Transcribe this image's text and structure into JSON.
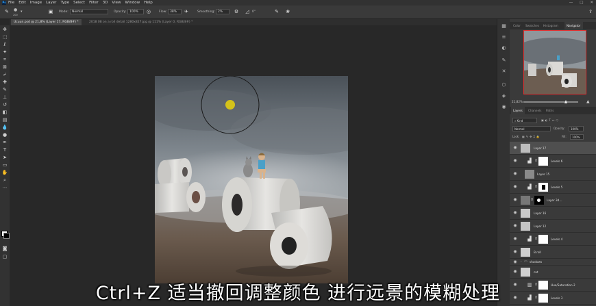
{
  "app": {
    "logo": "Ps"
  },
  "menubar": {
    "items": [
      "File",
      "Edit",
      "Image",
      "Layer",
      "Type",
      "Select",
      "Filter",
      "3D",
      "View",
      "Window",
      "Help"
    ]
  },
  "window_controls": {
    "minimize": "—",
    "maximize": "□",
    "close": "✕"
  },
  "options": {
    "brush_size": "200",
    "mode_label": "Mode:",
    "mode_value": "Normal",
    "opacity_label": "Opacity:",
    "opacity_value": "100%",
    "flow_label": "Flow:",
    "flow_value": "38%",
    "smoothing_label": "Smoothing:",
    "smoothing_value": "2%",
    "angle_value": "0°"
  },
  "tabs": [
    {
      "label": "Ucuun.psd @ 21,8% (Layer 17, RGB/8#) *",
      "active": true
    },
    {
      "label": "2018 08 on a roll detail 1280x827.jpg @ 111% (Layer 0, RGB/8#) *",
      "active": false
    }
  ],
  "navigator": {
    "tabs": [
      "Color",
      "Swatches",
      "Histogram",
      "Navigator"
    ],
    "active_tab": "Navigator",
    "zoom": "21,82%"
  },
  "layers_panel": {
    "tabs": [
      "Layers",
      "Channels",
      "Paths"
    ],
    "active_tab": "Layers",
    "filter_label": "Kind",
    "blend_mode": "Normal",
    "opacity_label": "Opacity:",
    "opacity_value": "100%",
    "lock_label": "Lock:",
    "fill_label": "Fill:",
    "fill_value": "100%"
  },
  "layers": [
    {
      "name": "Layer 17",
      "kind": "pixel",
      "selected": true
    },
    {
      "name": "Levels 6",
      "kind": "levels"
    },
    {
      "name": "Layer 15",
      "kind": "pixel"
    },
    {
      "name": "Levels 5",
      "kind": "levels"
    },
    {
      "name": "Layer 3d…",
      "kind": "masked"
    },
    {
      "name": "Layer 16",
      "kind": "pixel"
    },
    {
      "name": "Layer 12",
      "kind": "pixel"
    },
    {
      "name": "Levels 4",
      "kind": "levels"
    },
    {
      "name": "B.roll",
      "kind": "group"
    },
    {
      "name": "shadows",
      "kind": "group"
    },
    {
      "name": "cat",
      "kind": "pixel"
    },
    {
      "name": "Hue/Saturation 2",
      "kind": "huesat"
    },
    {
      "name": "Levels 3",
      "kind": "levels"
    }
  ],
  "subtitle": "Ctrl+Z 适当撤回调整颜色 进行远景的模糊处理",
  "colors": {
    "accent": "#31a8ff",
    "highlight": "#e03030",
    "brush_dot": "#d4c21a"
  }
}
